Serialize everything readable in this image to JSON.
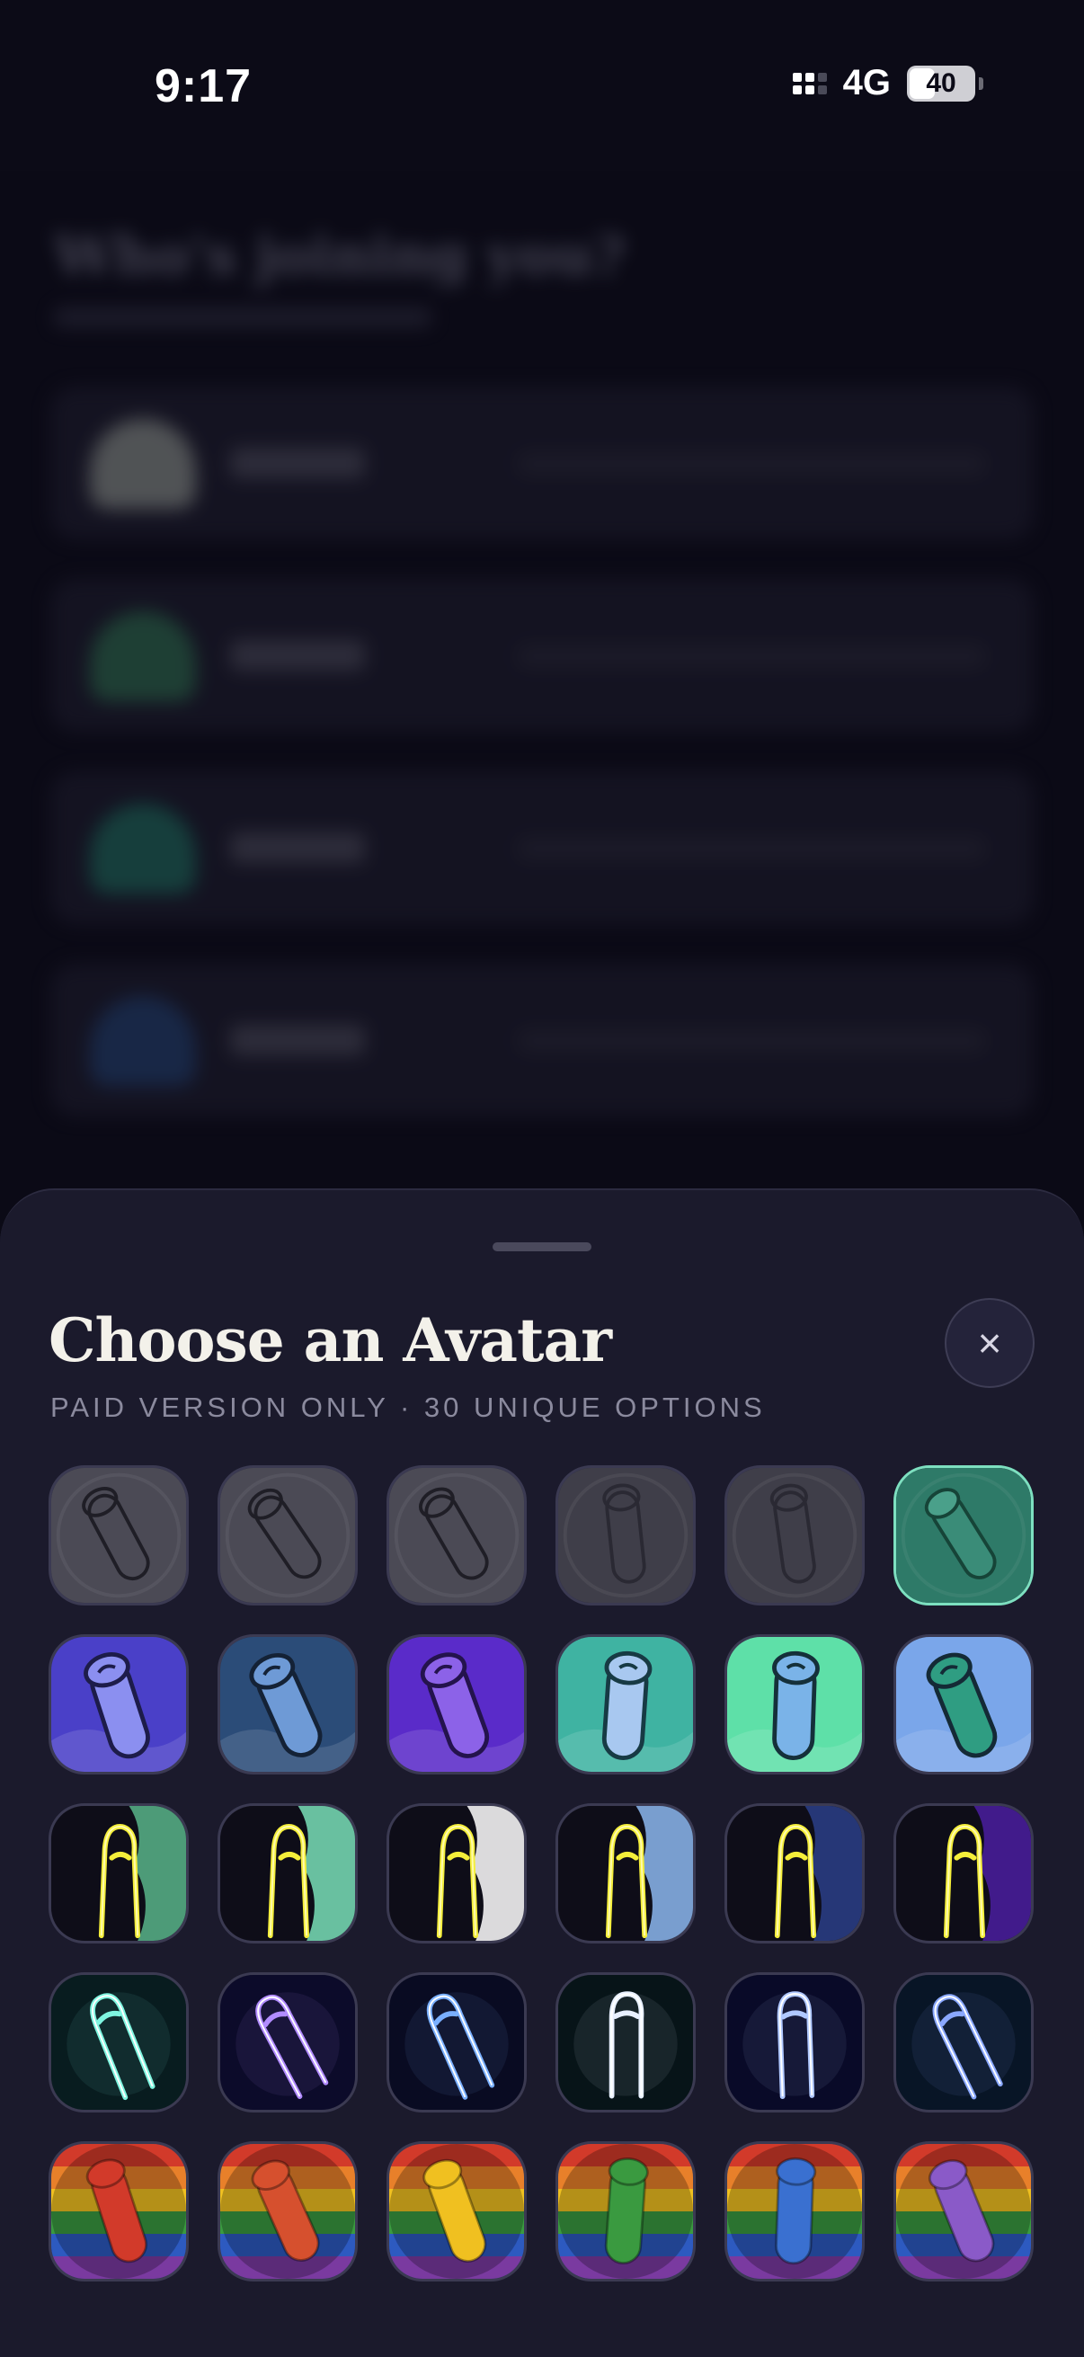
{
  "status": {
    "time": "9:17",
    "network": "4G",
    "battery": "40"
  },
  "background": {
    "title": "Who's joining you?"
  },
  "sheet": {
    "title": "Choose an Avatar",
    "subtitle": "PAID VERSION ONLY · 30 UNIQUE OPTIONS",
    "close_label": "×"
  },
  "avatars": [
    {
      "style": "sketch-gray",
      "bg": "#4b4a55",
      "fill": "none",
      "stroke": "#1f1e26",
      "selected": false
    },
    {
      "style": "sketch-gray",
      "bg": "#4b4a55",
      "fill": "none",
      "stroke": "#1f1e26",
      "selected": false
    },
    {
      "style": "sketch-gray",
      "bg": "#4b4a55",
      "fill": "none",
      "stroke": "#1f1e26",
      "selected": false
    },
    {
      "style": "sketch-gray",
      "bg": "#3f3e49",
      "fill": "none",
      "stroke": "#2a2933",
      "selected": false
    },
    {
      "style": "sketch-gray",
      "bg": "#3f3e49",
      "fill": "none",
      "stroke": "#2a2933",
      "selected": false
    },
    {
      "style": "sketch-teal",
      "bg": "#2e7a68",
      "fill": "#3a8c78",
      "stroke": "#164438",
      "selected": true
    },
    {
      "style": "cartoon",
      "bg": "#4a40c8",
      "fill": "#8b8ff0",
      "stroke": "#1d1c4a",
      "selected": false
    },
    {
      "style": "cartoon",
      "bg": "#2b4c78",
      "fill": "#6e9ad6",
      "stroke": "#142236",
      "selected": false
    },
    {
      "style": "cartoon",
      "bg": "#5a2bc9",
      "fill": "#8c62e8",
      "stroke": "#24134d",
      "selected": false
    },
    {
      "style": "cartoon",
      "bg": "#3fb3a2",
      "fill": "#a8c8f0",
      "stroke": "#173a44",
      "selected": false
    },
    {
      "style": "cartoon",
      "bg": "#5ee0a8",
      "fill": "#7ab3e8",
      "stroke": "#15303a",
      "selected": false
    },
    {
      "style": "cartoon",
      "bg": "#7aa6ea",
      "fill": "#2f9d82",
      "stroke": "#142a36",
      "selected": false
    },
    {
      "style": "neon-yellow",
      "bg": "#0e0d18",
      "accent": "#58b58a",
      "glow": "#f4ee3a",
      "selected": false
    },
    {
      "style": "neon-yellow",
      "bg": "#0e0d18",
      "accent": "#79e0b8",
      "glow": "#f4ee3a",
      "selected": false
    },
    {
      "style": "neon-yellow",
      "bg": "#0e0d18",
      "accent": "#ffffff",
      "glow": "#f4ee3a",
      "selected": false
    },
    {
      "style": "neon-yellow",
      "bg": "#0e0d18",
      "accent": "#8cb8f0",
      "glow": "#f4ee3a",
      "selected": false
    },
    {
      "style": "neon-yellow",
      "bg": "#0e0d18",
      "accent": "#2a3f88",
      "glow": "#f4ee3a",
      "selected": false
    },
    {
      "style": "neon-yellow",
      "bg": "#0e0d18",
      "accent": "#4a1fa0",
      "glow": "#f4ee3a",
      "selected": false
    },
    {
      "style": "neon-line",
      "bg": "#081c1f",
      "glow": "#7ff5e0",
      "selected": false
    },
    {
      "style": "neon-line",
      "bg": "#0c0b2a",
      "glow": "#b28cff",
      "selected": false
    },
    {
      "style": "neon-line",
      "bg": "#090b22",
      "glow": "#7ab0ff",
      "selected": false
    },
    {
      "style": "neon-line",
      "bg": "#071418",
      "glow": "#e8f0ff",
      "selected": false
    },
    {
      "style": "neon-line",
      "bg": "#090a28",
      "glow": "#b0c8ff",
      "selected": false
    },
    {
      "style": "neon-line",
      "bg": "#081526",
      "glow": "#8aa8ff",
      "selected": false
    },
    {
      "style": "rainbow",
      "bg": "#2d3a8a",
      "fill": "#d23a2a",
      "selected": false
    },
    {
      "style": "rainbow",
      "bg": "#2d3a8a",
      "fill": "#d6502e",
      "selected": false
    },
    {
      "style": "rainbow",
      "bg": "#2d3a8a",
      "fill": "#f0c020",
      "selected": false
    },
    {
      "style": "rainbow",
      "bg": "#2d3a8a",
      "fill": "#3a9a40",
      "selected": false
    },
    {
      "style": "rainbow",
      "bg": "#2d3a8a",
      "fill": "#3a70d0",
      "selected": false
    },
    {
      "style": "rainbow",
      "bg": "#2d3a8a",
      "fill": "#8a5ac8",
      "selected": false
    }
  ]
}
